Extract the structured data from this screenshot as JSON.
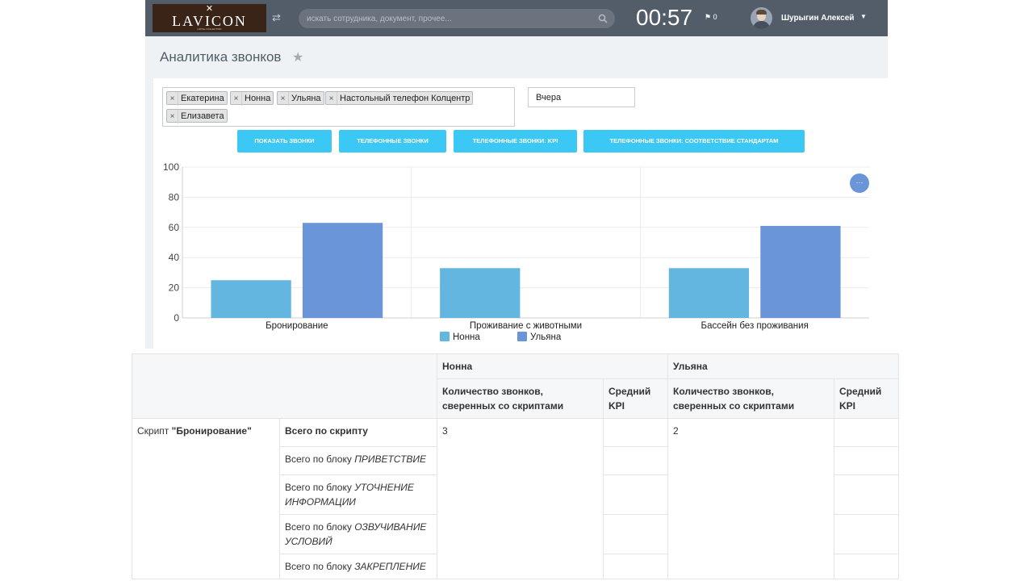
{
  "header": {
    "logo": "LAVICON",
    "logo_sub": "HOTEL COLLECTION",
    "search_placeholder": "искать сотрудника, документ, прочее...",
    "clock": "00:57",
    "notifications": "0",
    "user_name": "Шурыгин Алексей"
  },
  "page": {
    "title": "Аналитика звонков"
  },
  "filters": {
    "tags": [
      "Екатерина",
      "Нонна",
      "Ульяна",
      "Настольный телефон Колцентр",
      "Елизавета"
    ],
    "tag_remove": "×",
    "date": "Вчера"
  },
  "buttons": [
    "ПОКАЗАТЬ ЗВОНКИ",
    "ТЕЛЕФОННЫЕ ЗВОНКИ",
    "ТЕЛЕФОННЫЕ ЗВОНКИ: KPI",
    "ТЕЛЕФОННЫЕ ЗВОНКИ: СООТВЕТСТВИЕ СТАНДАРТАМ"
  ],
  "chart_data": {
    "type": "bar",
    "categories": [
      "Бронирование",
      "Проживание с животными",
      "Бассейн без проживания"
    ],
    "series": [
      {
        "name": "Нонна",
        "values": [
          25,
          33,
          33
        ],
        "color": "#62b6df"
      },
      {
        "name": "Ульяна",
        "values": [
          63,
          0,
          61
        ],
        "color": "#6a95d8"
      }
    ],
    "ylim": [
      0,
      100
    ],
    "yticks": [
      0,
      20,
      40,
      60,
      80,
      100
    ],
    "grid": true,
    "legend": "bottom-center"
  },
  "table": {
    "operators": [
      "Нонна",
      "Ульяна"
    ],
    "col_calls": "Количество звонков, сверенных со скриптами",
    "col_kpi": "Средний KPI",
    "script_prefix": "Скрипт",
    "script_name": "\"Бронирование\"",
    "total_label": "Всего по скрипту",
    "block_prefix": "Всего по блоку",
    "blocks": [
      "ПРИВЕТСТВИЕ",
      "УТОЧНЕНИЕ ИНФОРМАЦИИ",
      "ОЗВУЧИВАНИЕ УСЛОВИЙ",
      "ЗАКРЕПЛЕНИЕ"
    ],
    "counts": [
      "3",
      "2"
    ]
  }
}
